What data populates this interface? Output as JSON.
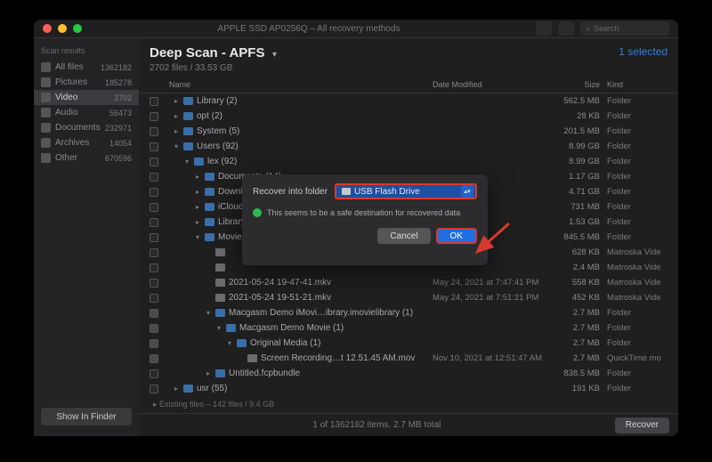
{
  "window": {
    "title": "APPLE SSD AP0256Q – All recovery methods",
    "search_placeholder": "Search"
  },
  "sidebar": {
    "header": "Scan results",
    "items": [
      {
        "label": "All files",
        "count": "1362182"
      },
      {
        "label": "Pictures",
        "count": "185278"
      },
      {
        "label": "Video",
        "count": "3702",
        "selected": true
      },
      {
        "label": "Audio",
        "count": "56473"
      },
      {
        "label": "Documents",
        "count": "232971"
      },
      {
        "label": "Archives",
        "count": "14054"
      },
      {
        "label": "Other",
        "count": "670596"
      }
    ],
    "footer_button": "Show In Finder"
  },
  "header": {
    "title": "Deep Scan - APFS",
    "subtitle": "2702 files / 33.53 GB",
    "selected": "1 selected"
  },
  "columns": {
    "name": "Name",
    "date": "Date Modified",
    "size": "Size",
    "kind": "Kind"
  },
  "rows": [
    {
      "indent": 1,
      "disc": "▸",
      "type": "folder",
      "name": "Library (2)",
      "date": "",
      "size": "562.5 MB",
      "kind": "Folder",
      "chk": false
    },
    {
      "indent": 1,
      "disc": "▸",
      "type": "folder",
      "name": "opt (2)",
      "date": "",
      "size": "28 KB",
      "kind": "Folder",
      "chk": false
    },
    {
      "indent": 1,
      "disc": "▸",
      "type": "folder",
      "name": "System (5)",
      "date": "",
      "size": "201.5 MB",
      "kind": "Folder",
      "chk": false
    },
    {
      "indent": 1,
      "disc": "▾",
      "type": "folder",
      "name": "Users (92)",
      "date": "",
      "size": "8.99 GB",
      "kind": "Folder",
      "chk": false
    },
    {
      "indent": 2,
      "disc": "▾",
      "type": "folder",
      "name": "lex (92)",
      "date": "",
      "size": "8.99 GB",
      "kind": "Folder",
      "chk": false
    },
    {
      "indent": 3,
      "disc": "▸",
      "type": "folder",
      "name": "Documents (14)",
      "date": "",
      "size": "1.17 GB",
      "kind": "Folder",
      "chk": false
    },
    {
      "indent": 3,
      "disc": "▸",
      "type": "folder",
      "name": "Downloads (22)",
      "date": "",
      "size": "4.71 GB",
      "kind": "Folder",
      "chk": false
    },
    {
      "indent": 3,
      "disc": "▸",
      "type": "folder",
      "name": "iCloud Drive",
      "date": "",
      "size": "731 MB",
      "kind": "Folder",
      "chk": false
    },
    {
      "indent": 3,
      "disc": "▸",
      "type": "folder",
      "name": "Library (8)",
      "date": "",
      "size": "1.53 GB",
      "kind": "Folder",
      "chk": false
    },
    {
      "indent": 3,
      "disc": "▾",
      "type": "folder",
      "name": "Movies (48)",
      "date": "",
      "size": "845.5 MB",
      "kind": "Folder",
      "chk": false
    },
    {
      "indent": 4,
      "disc": "",
      "type": "file",
      "name": "",
      "date": "",
      "size": "628 KB",
      "kind": "Matroska Vide",
      "chk": false
    },
    {
      "indent": 4,
      "disc": "",
      "type": "file",
      "name": "",
      "date": "",
      "size": "2.4 MB",
      "kind": "Matroska Vide",
      "chk": false
    },
    {
      "indent": 4,
      "disc": "",
      "type": "file",
      "name": "2021-05-24 19-47-41.mkv",
      "date": "May 24, 2021 at 7:47:41 PM",
      "size": "558 KB",
      "kind": "Matroska Vide",
      "chk": false
    },
    {
      "indent": 4,
      "disc": "",
      "type": "file",
      "name": "2021-05-24 19-51-21.mkv",
      "date": "May 24, 2021 at 7:51:21 PM",
      "size": "452 KB",
      "kind": "Matroska Vide",
      "chk": false
    },
    {
      "indent": 4,
      "disc": "▾",
      "type": "folder",
      "name": "Macgasm Demo iMovi…ibrary.imovielibrary (1)",
      "date": "",
      "size": "2.7 MB",
      "kind": "Folder",
      "chk": true
    },
    {
      "indent": 5,
      "disc": "▾",
      "type": "folder",
      "name": "Macgasm Demo Movie (1)",
      "date": "",
      "size": "2.7 MB",
      "kind": "Folder",
      "chk": true
    },
    {
      "indent": 6,
      "disc": "▾",
      "type": "folder",
      "name": "Original Media (1)",
      "date": "",
      "size": "2.7 MB",
      "kind": "Folder",
      "chk": true
    },
    {
      "indent": 7,
      "disc": "",
      "type": "file",
      "name": "Screen Recording…t 12.51.45 AM.mov",
      "date": "Nov 10, 2021 at 12:51:47 AM",
      "size": "2.7 MB",
      "kind": "QuickTime mo",
      "chk": true
    },
    {
      "indent": 4,
      "disc": "▸",
      "type": "folder",
      "name": "Untitled.fcpbundle",
      "date": "",
      "size": "838.5 MB",
      "kind": "Folder",
      "chk": false
    },
    {
      "indent": 1,
      "disc": "▸",
      "type": "folder",
      "name": "usr (55)",
      "date": "",
      "size": "191 KB",
      "kind": "Folder",
      "chk": false
    }
  ],
  "footline": "Existing files – 142 files / 9.4 GB",
  "statusbar": {
    "info": "1 of 1362182 items, 2.7 MB total",
    "recover": "Recover"
  },
  "modal": {
    "label": "Recover into folder",
    "selected": "USB Flash Drive",
    "message": "This seems to be a safe destination for recovered data",
    "cancel": "Cancel",
    "ok": "OK"
  }
}
